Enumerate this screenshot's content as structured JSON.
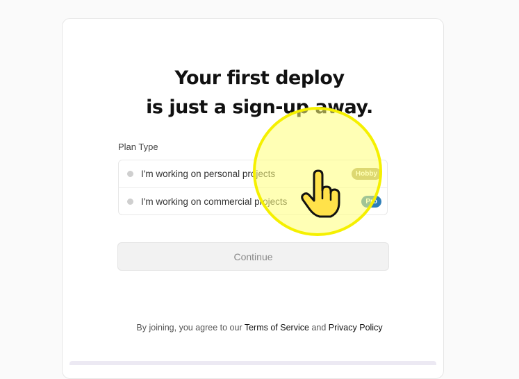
{
  "heading": {
    "line1": "Your first deploy",
    "line2": "is just a sign-up away."
  },
  "plan": {
    "label": "Plan Type",
    "options": [
      {
        "label": "I'm working on personal projects",
        "badge": "Hobby",
        "badge_color": "#b3a86a"
      },
      {
        "label": "I'm working on commercial projects",
        "badge": "Pro",
        "badge_color": "#2f7fb8"
      }
    ]
  },
  "continue_label": "Continue",
  "legal": {
    "prefix": "By joining, you agree to our",
    "terms": "Terms of Service",
    "and": "and",
    "privacy": "Privacy Policy"
  },
  "cursor": {
    "icon": "pointer-hand-icon",
    "highlight_color": "#f5f000"
  }
}
